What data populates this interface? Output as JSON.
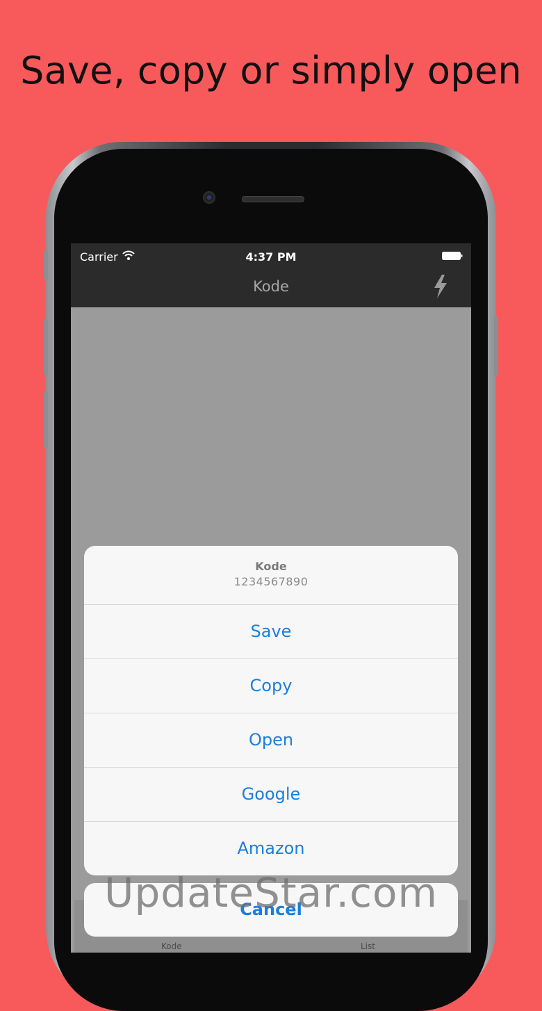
{
  "headline": "Save, copy or simply open",
  "status_bar": {
    "carrier": "Carrier",
    "time": "4:37 PM"
  },
  "nav_bar": {
    "title": "Kode",
    "flash_icon": "lightning-bolt-icon"
  },
  "action_sheet": {
    "title": "Kode",
    "message": "1234567890",
    "actions": [
      "Save",
      "Copy",
      "Open",
      "Google",
      "Amazon"
    ],
    "cancel": "Cancel"
  },
  "tab_bar": {
    "items": [
      "Kode",
      "List"
    ]
  },
  "watermark": "UpdateStar.com",
  "colors": {
    "background": "#f85a5b",
    "action_text": "#1a7ee0",
    "bar_background": "#2b2b2b"
  }
}
